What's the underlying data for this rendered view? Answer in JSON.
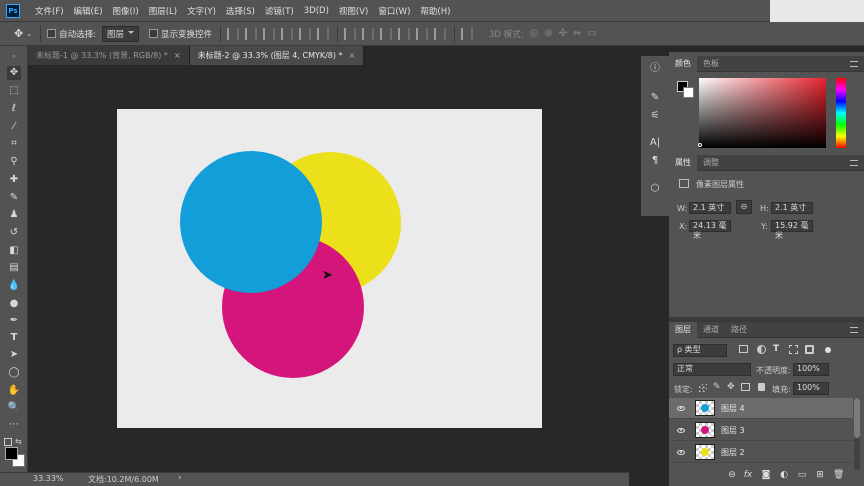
{
  "app": {
    "logo": "Ps"
  },
  "menu": [
    "文件(F)",
    "编辑(E)",
    "图像(I)",
    "图层(L)",
    "文字(Y)",
    "选择(S)",
    "滤镜(T)",
    "3D(D)",
    "视图(V)",
    "窗口(W)",
    "帮助(H)"
  ],
  "options": {
    "auto_select_label": "自动选择:",
    "auto_select_value": "图层",
    "show_transform_label": "显示变换控件",
    "mode_3d_label": "3D 模式:"
  },
  "tabs": [
    {
      "label": "未标题-1 @ 33.3% (背景, RGB/8) *",
      "close": "×"
    },
    {
      "label": "未标题-2 @ 33.3% (图层 4, CMYK/8) *",
      "close": "×"
    }
  ],
  "colors": {
    "cyan": "#139ed9",
    "yellow": "#ece01a",
    "magenta": "#d4157b",
    "doc_bg": "#ebebeb",
    "accent": "#31a8ff"
  },
  "status": {
    "zoom": "33.33%",
    "doc": "文档:10.2M/6.00M",
    "arrow": "›"
  },
  "color_panel": {
    "tab1": "颜色",
    "tab2": "色板"
  },
  "properties_panel": {
    "tab1": "属性",
    "tab2": "调整",
    "section": "像素图层属性",
    "w_label": "W:",
    "w_value": "2.1 英寸",
    "h_label": "H:",
    "h_value": "2.1 英寸",
    "x_label": "X:",
    "x_value": "24.13 毫米",
    "y_label": "Y:",
    "y_value": "15.92 毫米"
  },
  "layers_panel": {
    "tab1": "图层",
    "tab2": "通道",
    "tab3": "路径",
    "filter": "ρ 类型",
    "blend_mode": "正常",
    "opacity_label": "不透明度:",
    "opacity_value": "100%",
    "lock_label": "锁定:",
    "fill_label": "填充:",
    "fill_value": "100%",
    "layers": [
      {
        "name": "图层 4",
        "color": "#139ed9",
        "selected": true
      },
      {
        "name": "图层 3",
        "color": "#d4157b",
        "selected": false
      },
      {
        "name": "图层 2",
        "color": "#ece01a",
        "selected": false
      }
    ]
  },
  "toolbar_icons": [
    "move-icon",
    "marquee-icon",
    "lasso-icon",
    "magic-wand-icon",
    "crop-icon",
    "eyedropper-icon",
    "healing-brush-icon",
    "brush-icon",
    "clone-stamp-icon",
    "history-brush-icon",
    "eraser-icon",
    "gradient-icon",
    "blur-icon",
    "dodge-icon",
    "pen-icon",
    "type-icon",
    "path-selection-icon",
    "shape-icon",
    "hand-icon",
    "zoom-icon",
    "more-tools-icon"
  ]
}
